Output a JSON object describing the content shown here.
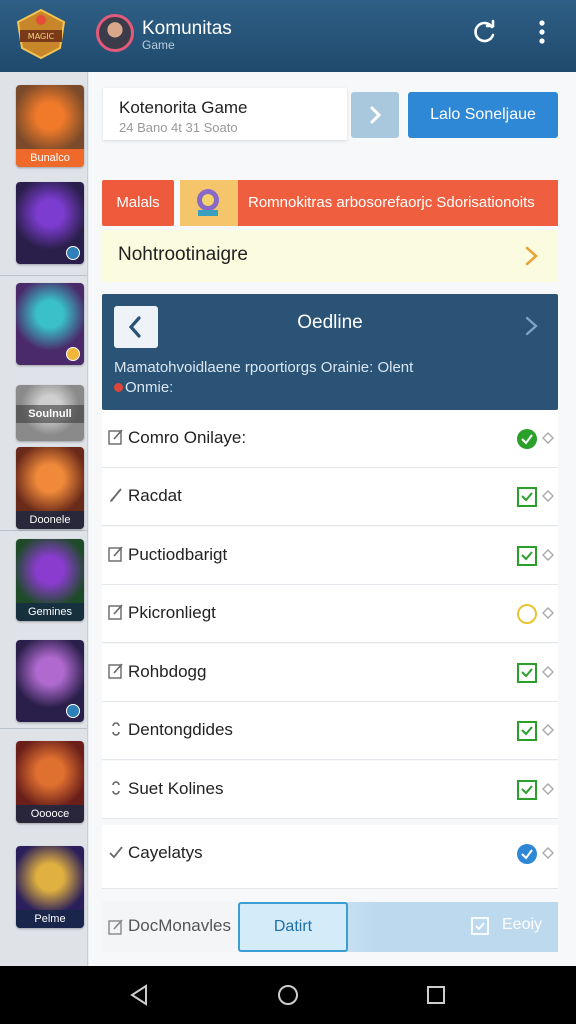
{
  "header": {
    "title": "Komunitas",
    "subtitle": "Game",
    "logo_icon": "game-logo",
    "refresh_icon": "refresh-icon",
    "more_icon": "more-vertical-icon"
  },
  "sidebar": {
    "items": [
      {
        "caption": "Bunalco",
        "colors": [
          "#7a4a2a",
          "#f07a2a"
        ],
        "badge": ""
      },
      {
        "caption": "",
        "colors": [
          "#2a1f4a",
          "#7b3ccf"
        ],
        "badge": "arrow"
      },
      {
        "caption": "",
        "colors": [
          "#4a2a6a",
          "#39c0c8"
        ],
        "badge": "coin"
      },
      {
        "caption": "Soulnull",
        "colors": [
          "#8a8a8a",
          "#cfcfcf"
        ],
        "badge": ""
      },
      {
        "caption": "Doonele",
        "colors": [
          "#6a2a1a",
          "#f08a3a"
        ],
        "badge": ""
      },
      {
        "caption": "Gemines",
        "colors": [
          "#1f4a2a",
          "#8a3ccf"
        ],
        "badge": ""
      },
      {
        "caption": "",
        "colors": [
          "#2a1f4a",
          "#b06acf"
        ],
        "badge": "globe"
      },
      {
        "caption": "Ooooce",
        "colors": [
          "#6a1f1a",
          "#e07030"
        ],
        "badge": ""
      },
      {
        "caption": "Pelme",
        "colors": [
          "#2a1f5a",
          "#e0b040"
        ],
        "badge": ""
      }
    ]
  },
  "top_card": {
    "title": "Kotenorita Game",
    "meta": "24 Bano  4t 31 Soato",
    "action_label": "Lalo Soneljaue"
  },
  "alert": {
    "tag": "Malals",
    "text": "Romnokitras arbosorefaorjc Sdorisationoits"
  },
  "notice": {
    "text": "Nohtrootinaigre"
  },
  "panel": {
    "title": "Oedline",
    "body": "Mamatohvoidlaene rpoortiorgs Orainie: Olent ",
    "body_tail": "Onmie:"
  },
  "list": [
    {
      "label": "Comro Onilaye:",
      "lead": "edit",
      "status": "check-circle",
      "status_color": "#2aa02a"
    },
    {
      "label": "Racdat",
      "lead": "pen",
      "status": "check-box",
      "status_color": "#2aa02a"
    },
    {
      "label": "Puctiodbarigt",
      "lead": "edit",
      "status": "check-box",
      "status_color": "#2aa02a"
    },
    {
      "label": "Pkicronliegt",
      "lead": "edit",
      "status": "pending-circle",
      "status_color": "#e8c530"
    },
    {
      "label": "Rohbdogg",
      "lead": "edit",
      "status": "check-box",
      "status_color": "#2aa02a"
    },
    {
      "label": "Dentongdides",
      "lead": "link",
      "status": "check-box",
      "status_color": "#2aa02a"
    },
    {
      "label": "Suet Kolines",
      "lead": "link",
      "status": "check-box",
      "status_color": "#2aa02a"
    },
    {
      "label": "Cayelatys",
      "lead": "check",
      "status": "check-circle",
      "status_color": "#2f88d6"
    }
  ],
  "bottom": {
    "label": "DocMonavles",
    "default_button": "Datirt",
    "right_label": "Eeoiy"
  },
  "navbar": {
    "back_icon": "back-triangle-icon",
    "home_icon": "home-circle-icon",
    "recents_icon": "recents-square-icon"
  }
}
